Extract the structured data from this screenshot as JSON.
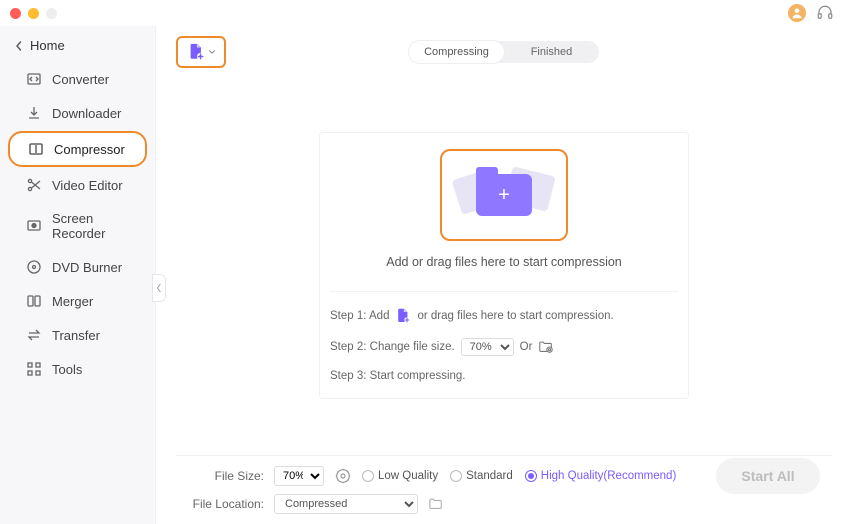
{
  "titlebar": {
    "avatar_initial": ""
  },
  "sidebar": {
    "home": "Home",
    "items": [
      {
        "label": "Converter"
      },
      {
        "label": "Downloader"
      },
      {
        "label": "Compressor"
      },
      {
        "label": "Video Editor"
      },
      {
        "label": "Screen Recorder"
      },
      {
        "label": "DVD Burner"
      },
      {
        "label": "Merger"
      },
      {
        "label": "Transfer"
      },
      {
        "label": "Tools"
      }
    ],
    "active_index": 2
  },
  "tabs": {
    "compressing": "Compressing",
    "finished": "Finished"
  },
  "dropzone": {
    "hint": "Add or drag files here to start compression"
  },
  "steps": {
    "s1_prefix": "Step 1: Add",
    "s1_suffix": "or drag files here to start compression.",
    "s2_prefix": "Step 2: Change file size.",
    "s2_percent": "70%",
    "s2_or": "Or",
    "s3": "Step 3: Start compressing."
  },
  "footer": {
    "file_size_label": "File Size:",
    "file_size_value": "70%",
    "file_location_label": "File Location:",
    "file_location_value": "Compressed",
    "quality": {
      "low": "Low Quality",
      "standard": "Standard",
      "high": "High Quality(Recommend)"
    },
    "start_all": "Start All"
  }
}
